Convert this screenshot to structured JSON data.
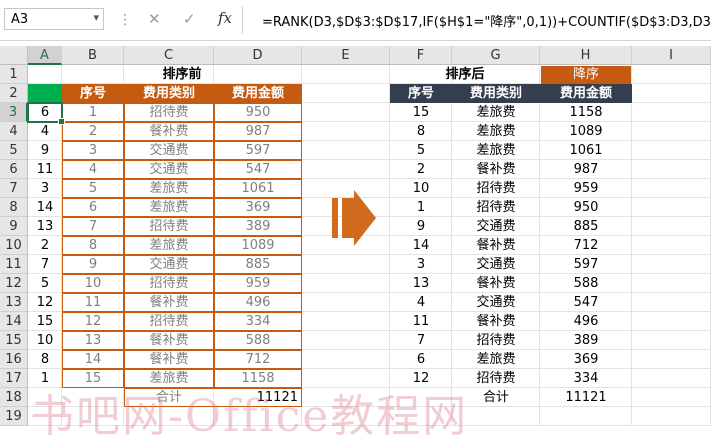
{
  "name_box": "A3",
  "formula": "=RANK(D3,$D$3:$D$17,IF($H$1=\"降序\",0,1))+COUNTIF($D$3:D3,D3)-1",
  "formula_icons": [
    "cancel-icon",
    "confirm-icon",
    "function-icon"
  ],
  "fx_label": "fx",
  "columns": [
    "A",
    "B",
    "C",
    "D",
    "E",
    "F",
    "G",
    "H",
    "I"
  ],
  "rows": [
    "1",
    "2",
    "3",
    "4",
    "5",
    "6",
    "7",
    "8",
    "9",
    "10",
    "11",
    "12",
    "13",
    "14",
    "15",
    "16",
    "17",
    "18",
    "19"
  ],
  "titles": {
    "before": "排序前",
    "after": "排序后",
    "order": "降序"
  },
  "left_headers": [
    "序号",
    "费用类别",
    "费用金额"
  ],
  "right_headers": [
    "序号",
    "费用类别",
    "费用金额"
  ],
  "rank_col": [
    "6",
    "4",
    "9",
    "11",
    "3",
    "14",
    "13",
    "2",
    "7",
    "5",
    "12",
    "15",
    "10",
    "8",
    "1"
  ],
  "left_table": [
    [
      "1",
      "招待费",
      "950"
    ],
    [
      "2",
      "餐补费",
      "987"
    ],
    [
      "3",
      "交通费",
      "597"
    ],
    [
      "4",
      "交通费",
      "547"
    ],
    [
      "5",
      "差旅费",
      "1061"
    ],
    [
      "6",
      "差旅费",
      "369"
    ],
    [
      "7",
      "招待费",
      "389"
    ],
    [
      "8",
      "差旅费",
      "1089"
    ],
    [
      "9",
      "交通费",
      "885"
    ],
    [
      "10",
      "招待费",
      "959"
    ],
    [
      "11",
      "餐补费",
      "496"
    ],
    [
      "12",
      "招待费",
      "334"
    ],
    [
      "13",
      "餐补费",
      "588"
    ],
    [
      "14",
      "餐补费",
      "712"
    ],
    [
      "15",
      "差旅费",
      "1158"
    ]
  ],
  "right_table": [
    [
      "15",
      "差旅费",
      "1158"
    ],
    [
      "8",
      "差旅费",
      "1089"
    ],
    [
      "5",
      "差旅费",
      "1061"
    ],
    [
      "2",
      "餐补费",
      "987"
    ],
    [
      "10",
      "招待费",
      "959"
    ],
    [
      "1",
      "招待费",
      "950"
    ],
    [
      "9",
      "交通费",
      "885"
    ],
    [
      "14",
      "餐补费",
      "712"
    ],
    [
      "3",
      "交通费",
      "597"
    ],
    [
      "13",
      "餐补费",
      "588"
    ],
    [
      "4",
      "交通费",
      "547"
    ],
    [
      "11",
      "餐补费",
      "496"
    ],
    [
      "7",
      "招待费",
      "389"
    ],
    [
      "6",
      "差旅费",
      "369"
    ],
    [
      "12",
      "招待费",
      "334"
    ]
  ],
  "totals": {
    "left_label": "合计",
    "left_value": "11121",
    "right_label": "合计",
    "right_value": "11121"
  },
  "watermark": "书吧网-Office教程网",
  "colors": {
    "orange": "#c55a11",
    "dark": "#333f4f",
    "green": "#217346",
    "arrow": "#d16a1c"
  }
}
